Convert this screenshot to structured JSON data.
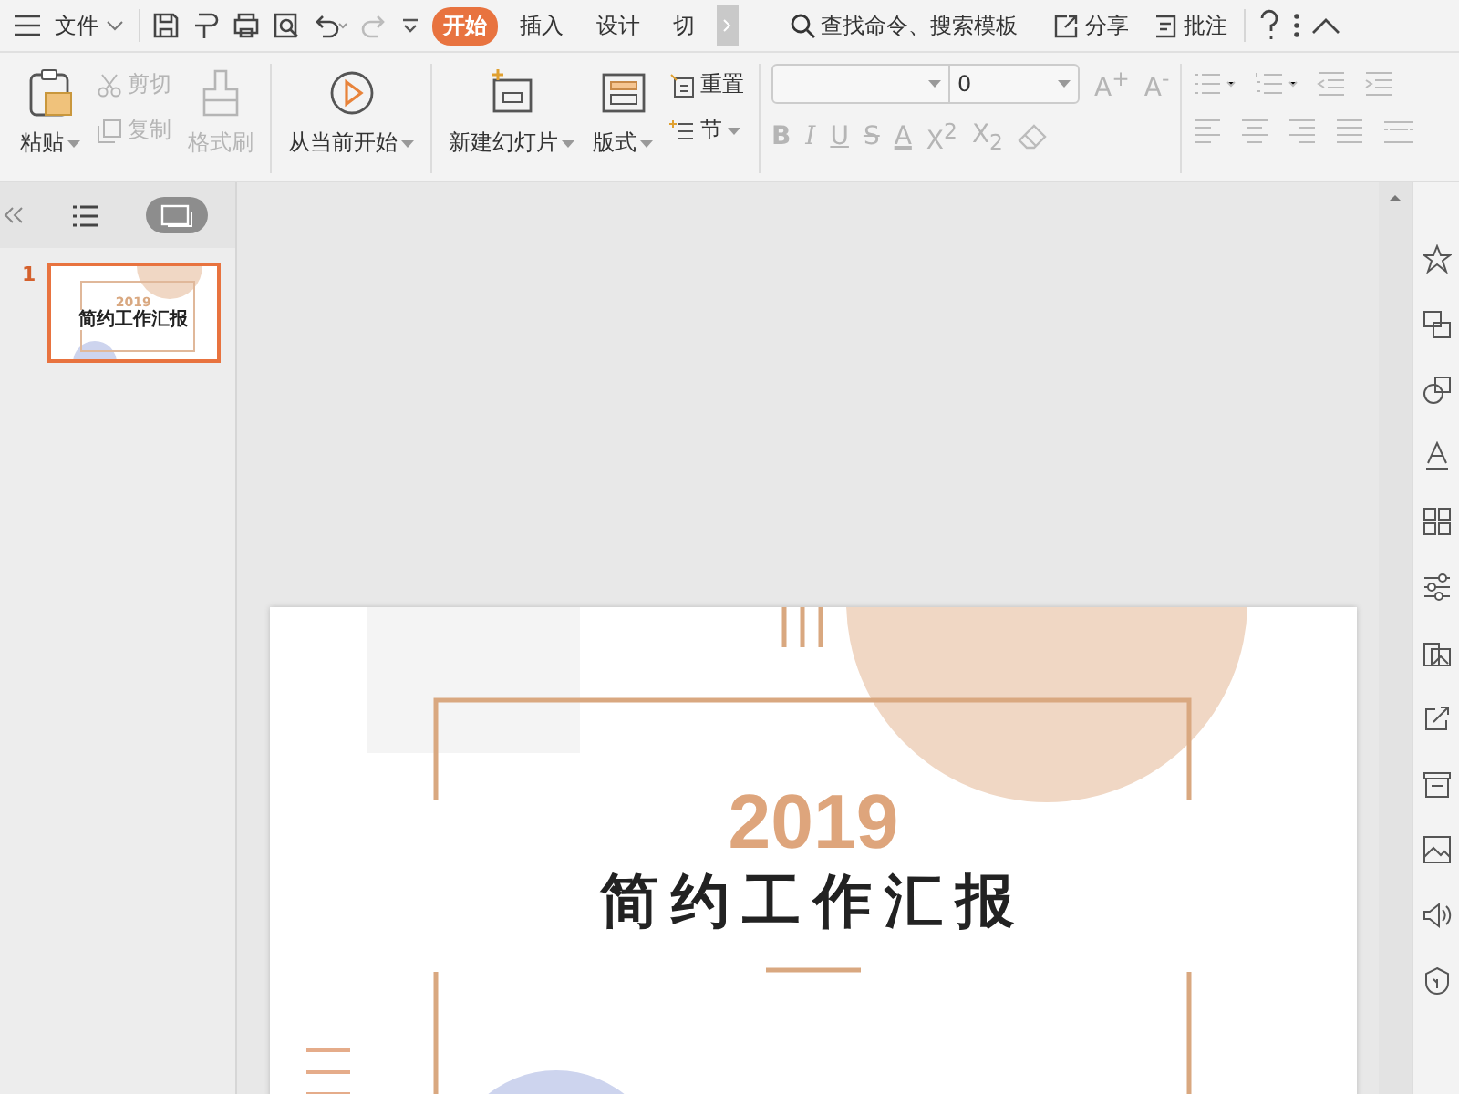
{
  "menu": {
    "label": "文件"
  },
  "tabs": [
    {
      "label": "开始",
      "selected": true
    },
    {
      "label": "插入",
      "selected": false
    },
    {
      "label": "设计",
      "selected": false
    },
    {
      "label": "切",
      "selected": false
    }
  ],
  "search": {
    "placeholder": "查找命令、搜索模板"
  },
  "actions": [
    {
      "label": "分享",
      "kind": "share"
    },
    {
      "label": "批注",
      "kind": "comment"
    }
  ],
  "clipboard": {
    "paste": {
      "label": "粘贴"
    },
    "cut": {
      "label": "剪切",
      "disabled": true
    },
    "copy": {
      "label": "复制",
      "disabled": true
    },
    "format_painter": {
      "label": "格式刷",
      "disabled": true
    }
  },
  "slideshow": {
    "label": "从当前开始"
  },
  "slides_group": {
    "new_slide": {
      "label": "新建幻灯片"
    },
    "layout": {
      "label": "版式"
    },
    "reset": {
      "label": "重置"
    },
    "section": {
      "label": "节"
    }
  },
  "font": {
    "size": "0",
    "size_buttons": [
      {
        "label": "A$^{+}$",
        "disabled": true
      },
      {
        "label": "A$^{-}$",
        "disabled": true
      }
    ]
  },
  "format_buttons": [
    {
      "label": "B",
      "kind": "bold",
      "disabled": true
    },
    {
      "label": "I",
      "kind": "italic",
      "disabled": true
    },
    {
      "label": "U",
      "kind": "underline",
      "disabled": true
    },
    {
      "label": "S",
      "kind": "strike",
      "disabled": true
    },
    {
      "label": "A",
      "kind": "color",
      "disabled": true
    },
    {
      "label": "X$^{2}$",
      "kind": "plain",
      "disabled": true
    },
    {
      "label": "X$_{2}$",
      "kind": "plain",
      "disabled": true
    }
  ],
  "view_toggles": [
    {
      "kind": "outline",
      "selected": false
    },
    {
      "kind": "slides",
      "selected": true
    }
  ],
  "thumbnails": [
    {
      "number": "1",
      "selected": true,
      "year": "2019",
      "title": "简约工作汇报"
    }
  ],
  "slide": {
    "year": "2019",
    "title": "简约工作汇报"
  }
}
